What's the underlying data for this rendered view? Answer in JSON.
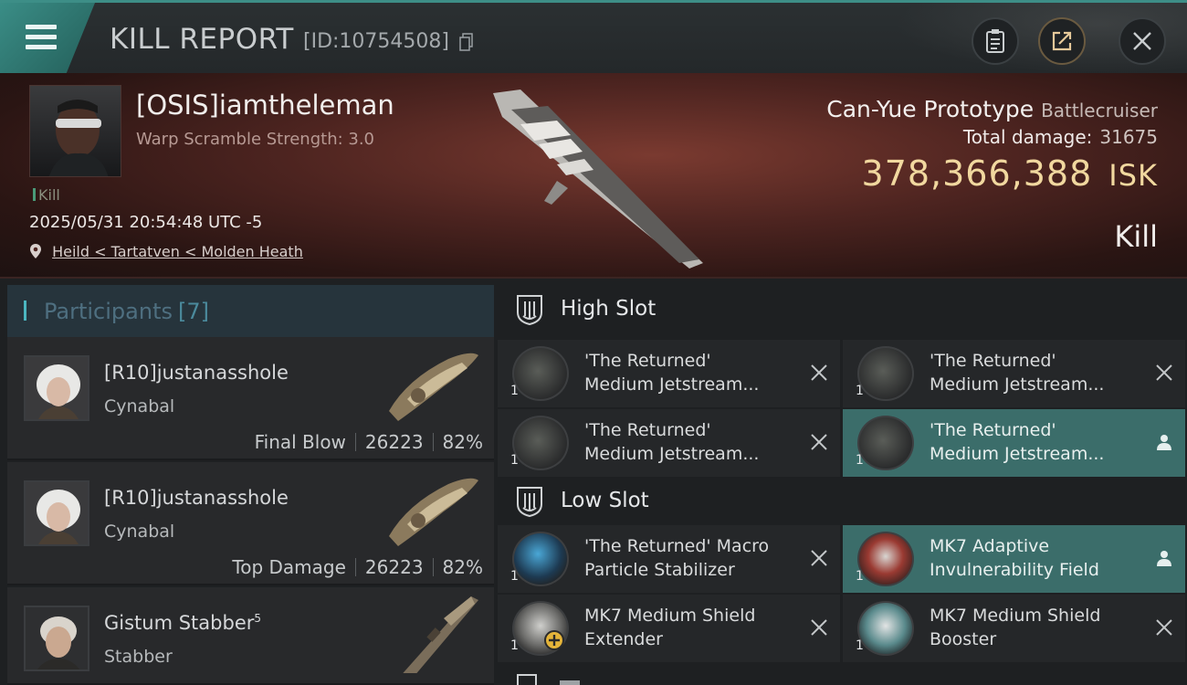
{
  "header": {
    "title": "KILL REPORT",
    "report_id": "[ID:10754508]",
    "menu_icon": "hamburger-menu-icon",
    "buttons": [
      "clipboard-icon",
      "share-icon",
      "close-icon"
    ]
  },
  "victim": {
    "name": "[OSIS]iamtheleman",
    "warp_scramble": "Warp Scramble Strength: 3.0",
    "tag": "Kill",
    "datetime": "2025/05/31 20:54:48 UTC -5",
    "location": "Heild < Tartatven < Molden Heath",
    "ship_name": "Can-Yue Prototype",
    "ship_class": "Battlecruiser",
    "total_damage_label": "Total damage:",
    "total_damage": "31675",
    "isk_value": "378,366,388",
    "isk_unit": "ISK",
    "result": "Kill"
  },
  "participants": {
    "label": "Participants",
    "count": "[7]",
    "items": [
      {
        "name": "[R10]justanasshole",
        "ship": "Cynabal",
        "role": "Final Blow",
        "damage": "26223",
        "percent": "82%"
      },
      {
        "name": "[R10]justanasshole",
        "ship": "Cynabal",
        "role": "Top Damage",
        "damage": "26223",
        "percent": "82%"
      },
      {
        "name": "Gistum Stabber",
        "name_sup": "5",
        "ship": "Stabber"
      }
    ]
  },
  "fitting": {
    "high_slot": {
      "label": "High Slot",
      "modules": [
        {
          "line1": "'The Returned'",
          "line2": "Medium Jetstream...",
          "qty": "1",
          "state": "destroyed"
        },
        {
          "line1": "'The Returned'",
          "line2": "Medium Jetstream...",
          "qty": "1",
          "state": "destroyed"
        },
        {
          "line1": "'The Returned'",
          "line2": "Medium Jetstream...",
          "qty": "1",
          "state": "destroyed"
        },
        {
          "line1": "'The Returned'",
          "line2": "Medium Jetstream...",
          "qty": "1",
          "state": "dropped"
        }
      ]
    },
    "low_slot": {
      "label": "Low Slot",
      "modules": [
        {
          "line1": "'The Returned' Macro",
          "line2": "Particle Stabilizer",
          "qty": "1",
          "state": "destroyed"
        },
        {
          "line1": "MK7 Adaptive",
          "line2": "Invulnerability Field",
          "qty": "1",
          "state": "dropped"
        },
        {
          "line1": "MK7 Medium Shield",
          "line2": "Extender",
          "qty": "1",
          "state": "destroyed"
        },
        {
          "line1": "MK7 Medium Shield",
          "line2": "Booster",
          "qty": "1",
          "state": "destroyed"
        }
      ]
    }
  },
  "colors": {
    "accent_teal": "#3b6d6a",
    "isk_gold": "#f1d89f",
    "participants_label": "#4e6f80"
  }
}
